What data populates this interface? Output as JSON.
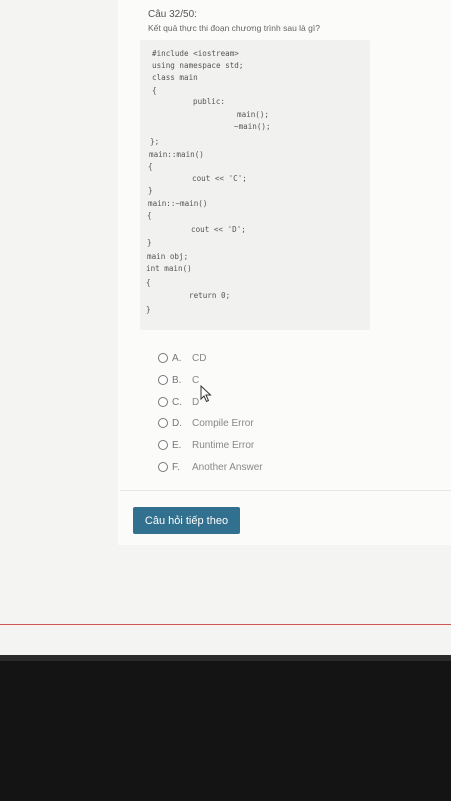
{
  "question": {
    "number": "Câu 32/50:",
    "text": "Kết quả thực thi đoạn chương trình sau là gì?"
  },
  "code": [
    "#include <iostream>",
    "using namespace std;",
    "class main",
    "{",
    "public:",
    "main();",
    "~main();",
    "};",
    "main::main()",
    "{",
    "cout << 'C';",
    "}",
    "main::~main()",
    "{",
    "cout << 'D';",
    "}",
    "main obj;",
    "int main()",
    "{",
    "return 0;",
    "}"
  ],
  "options": [
    {
      "letter": "A.",
      "text": "CD"
    },
    {
      "letter": "B.",
      "text": "C"
    },
    {
      "letter": "C.",
      "text": "D"
    },
    {
      "letter": "D.",
      "text": "Compile Error"
    },
    {
      "letter": "E.",
      "text": "Runtime Error"
    },
    {
      "letter": "F.",
      "text": "Another Answer"
    }
  ],
  "next_button": "Câu hỏi tiếp theo",
  "colors": {
    "button": "#31708e",
    "accent_line": "#c9302c"
  },
  "icons": {
    "cursor": "mouse-pointer-icon",
    "radio": "radio-circle-icon"
  }
}
